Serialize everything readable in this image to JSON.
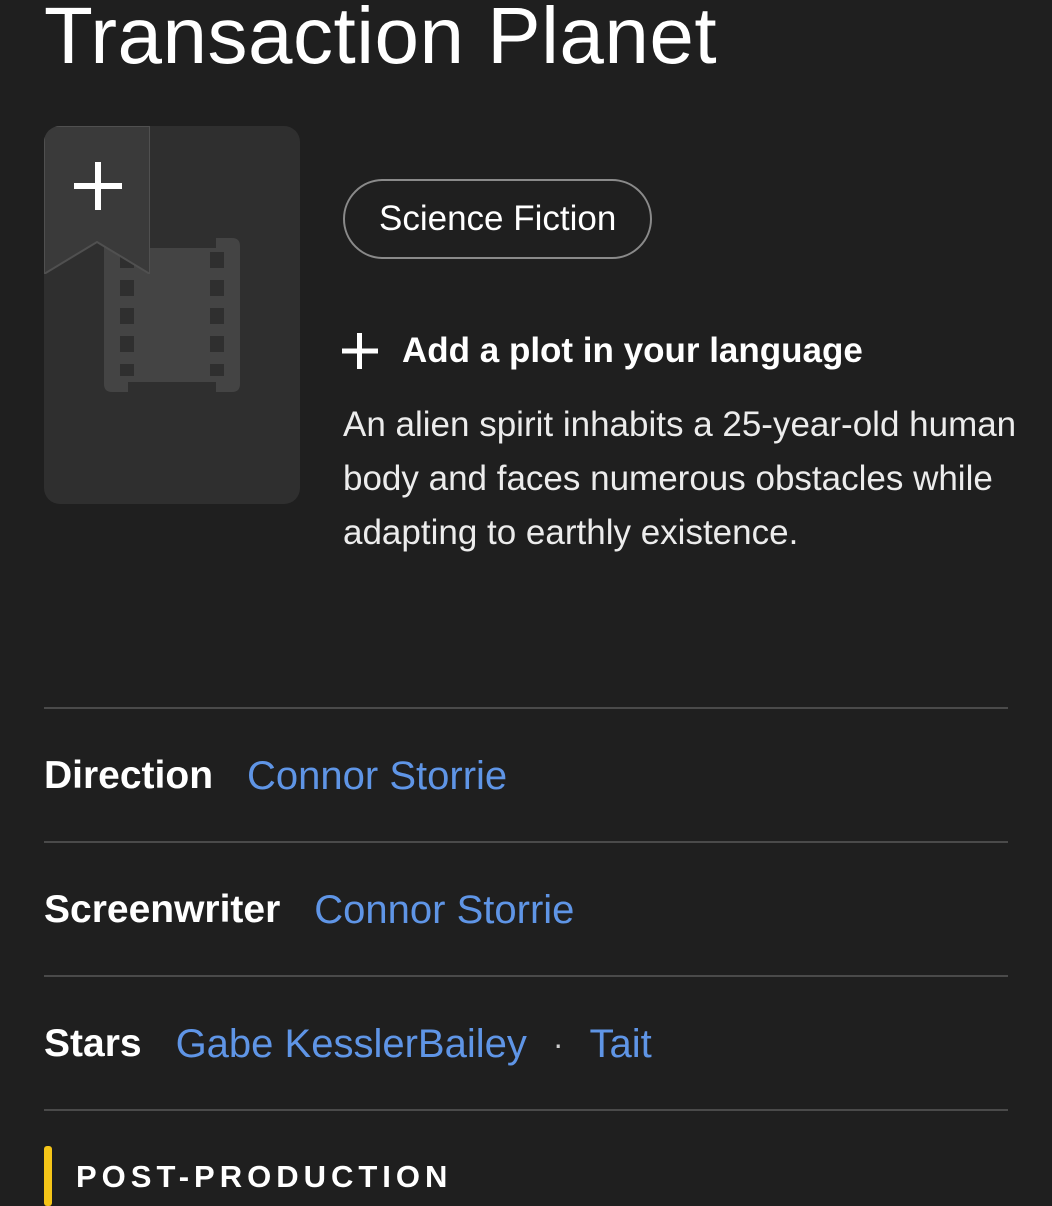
{
  "title": "Transaction Planet",
  "poster": {
    "placeholder_icon": "film-icon",
    "watchlist_icon": "plus-icon"
  },
  "genres": [
    "Science Fiction"
  ],
  "add_plot": {
    "icon": "plus-icon",
    "label": "Add a plot in your language"
  },
  "plot": "An alien spirit inhabits a 25-year-old human body and faces numerous obstacles while adapting to earthly existence.",
  "credits": {
    "direction": {
      "role": "Direction",
      "people": [
        "Connor Storrie"
      ]
    },
    "screenwriter": {
      "role": "Screenwriter",
      "people": [
        "Connor Storrie"
      ]
    },
    "stars": {
      "role": "Stars",
      "people": [
        "Gabe KesslerBailey",
        "Tait"
      ],
      "separator": "·"
    }
  },
  "status": {
    "label": "POST-PRODUCTION",
    "accent_color": "#f5c518"
  },
  "colors": {
    "background": "#1f1f1f",
    "link": "#5f95e6",
    "poster_bg": "#2f2f2f"
  }
}
